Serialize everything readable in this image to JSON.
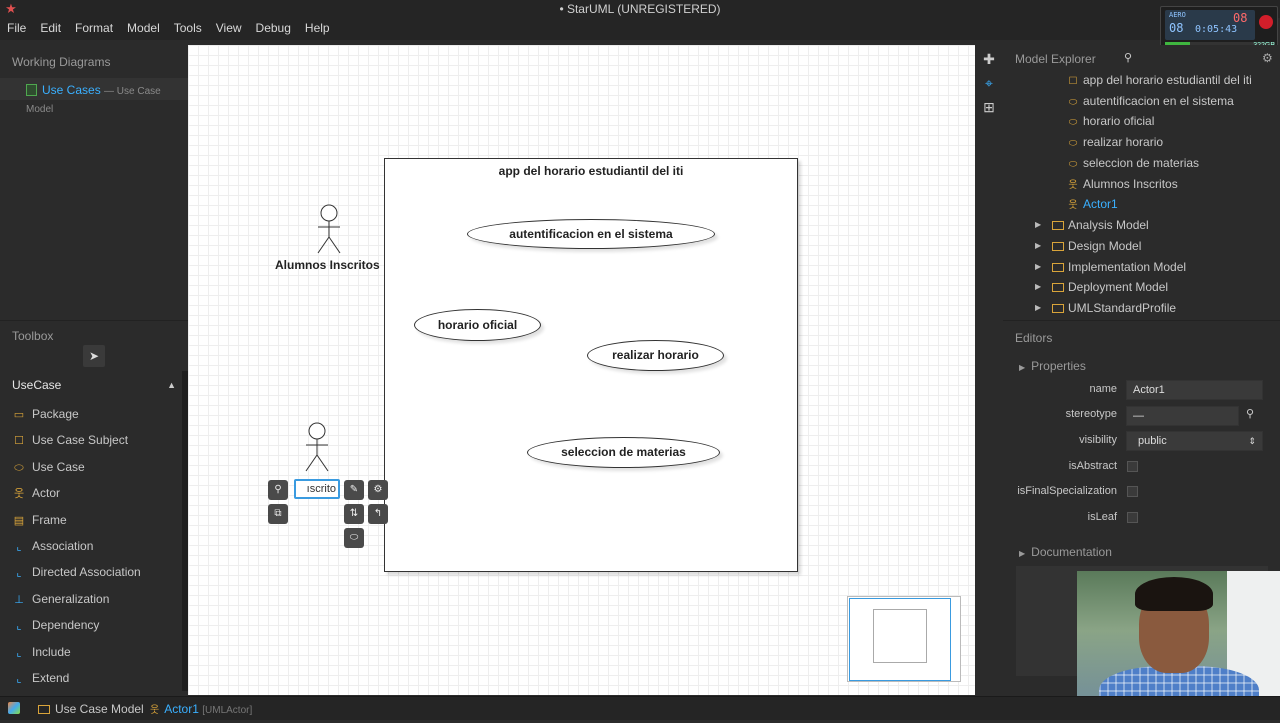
{
  "window": {
    "title": "• StarUML (UNREGISTERED)"
  },
  "menu": [
    "File",
    "Edit",
    "Format",
    "Model",
    "Tools",
    "View",
    "Debug",
    "Help"
  ],
  "recorder": {
    "line1": "AERO",
    "hours": "08",
    "time": "0:05:43",
    "frames": "08",
    "size": "322GB"
  },
  "working_diagrams": {
    "title": "Working Diagrams",
    "item": {
      "label": "Use Cases",
      "sub": "— Use Case Model"
    }
  },
  "toolbox": {
    "title": "Toolbox",
    "pointer_icon": "pointer-icon",
    "group": "UseCase",
    "tools": [
      {
        "label": "Package",
        "icon": "package-icon"
      },
      {
        "label": "Use Case Subject",
        "icon": "subject-icon"
      },
      {
        "label": "Use Case",
        "icon": "usecase-icon"
      },
      {
        "label": "Actor",
        "icon": "actor-icon"
      },
      {
        "label": "Frame",
        "icon": "frame-icon"
      },
      {
        "label": "Association",
        "icon": "association-icon"
      },
      {
        "label": "Directed Association",
        "icon": "directed-association-icon"
      },
      {
        "label": "Generalization",
        "icon": "generalization-icon"
      },
      {
        "label": "Dependency",
        "icon": "dependency-icon"
      },
      {
        "label": "Include",
        "icon": "include-icon"
      },
      {
        "label": "Extend",
        "icon": "extend-icon"
      }
    ]
  },
  "diagram": {
    "subject_title": "app del horario estudiantil del iti",
    "use_cases": [
      "autentificacion en el sistema",
      "horario oficial",
      "realizar horario",
      "seleccion de materias"
    ],
    "actor1_name": "Alumnos Inscritos",
    "editing_text": "ıscrito"
  },
  "model_explorer": {
    "title": "Model Explorer",
    "items": [
      {
        "label": "app del horario estudiantil del iti",
        "icon": "subject-icon"
      },
      {
        "label": "autentificacion en el sistema",
        "icon": "usecase-icon"
      },
      {
        "label": "horario oficial",
        "icon": "usecase-icon"
      },
      {
        "label": "realizar horario",
        "icon": "usecase-icon"
      },
      {
        "label": "seleccion de materias",
        "icon": "usecase-icon"
      },
      {
        "label": "Alumnos Inscritos",
        "icon": "actor-icon"
      },
      {
        "label": "Actor1",
        "icon": "actor-icon",
        "selected": true
      }
    ],
    "models": [
      "Analysis Model",
      "Design Model",
      "Implementation Model",
      "Deployment Model",
      "UMLStandardProfile"
    ]
  },
  "editors": {
    "title": "Editors",
    "properties_label": "Properties",
    "fields": {
      "name_label": "name",
      "name_value": "Actor1",
      "stereotype_label": "stereotype",
      "stereotype_value": "—",
      "visibility_label": "visibility",
      "visibility_value": "public",
      "isAbstract_label": "isAbstract",
      "isFinalSpecialization_label": "isFinalSpecialization",
      "isLeaf_label": "isLeaf"
    },
    "documentation_label": "Documentation"
  },
  "statusbar": {
    "model": "Use Case Model",
    "element": "Actor1",
    "element_type": "[UMLActor]"
  },
  "colors": {
    "accent": "#3ab0ff",
    "folder": "#d9a43a",
    "canvas": "#ffffff"
  }
}
